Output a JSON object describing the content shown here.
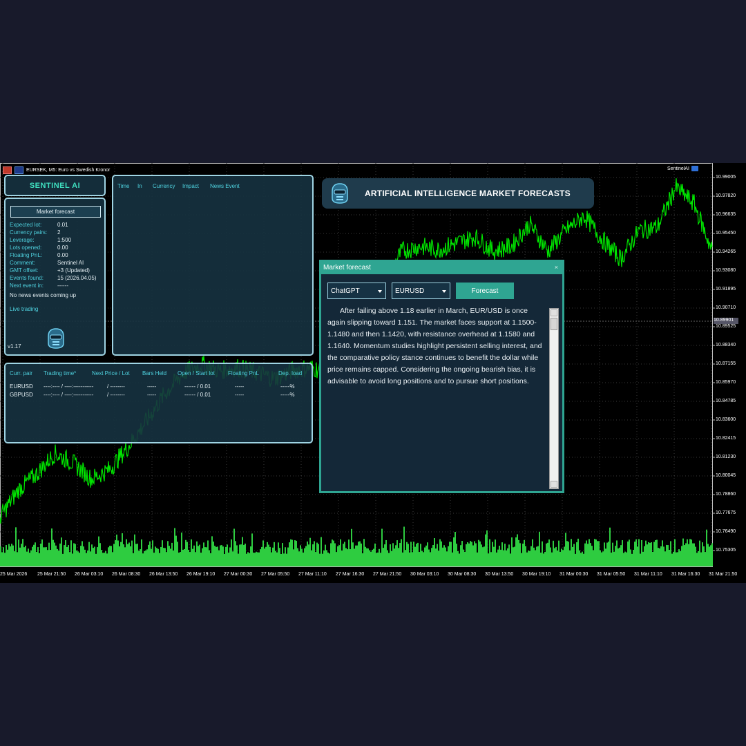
{
  "window": {
    "symbol_title": "EURSEK, M5:  Euro vs Swedish Kronor",
    "brand_tag": "SentinelAI"
  },
  "colors": {
    "accent_teal": "#2fa592",
    "price_line": "#00e600",
    "volume": "#2ecc40",
    "panel_border": "#9fd4e3",
    "label_cyan": "#4fd3e0"
  },
  "header": {
    "title": "SENTINEL AI"
  },
  "info_panel": {
    "button": "Market forecast",
    "rows": [
      {
        "label": "Expected lot:",
        "value": "0.01"
      },
      {
        "label": "Currency pairs:",
        "value": "2"
      },
      {
        "label": "Leverage:",
        "value": "1:500"
      },
      {
        "label": "Lots opened:",
        "value": "0.00"
      },
      {
        "label": "Floating PnL:",
        "value": "0.00"
      },
      {
        "label": "Comment:",
        "value": "Sentinel AI"
      },
      {
        "label": "GMT offset:",
        "value": "+3 (Updated)"
      },
      {
        "label": "Events found:",
        "value": "15 (2026.04.05)"
      },
      {
        "label": "Next event in:",
        "value": "------"
      }
    ],
    "no_news": "No news events coming up",
    "live": "Live trading",
    "version": "v1.17"
  },
  "news_panel": {
    "headers": [
      "Time",
      "In",
      "Currency",
      "Impact",
      "News Event"
    ]
  },
  "trade_panel": {
    "headers": [
      "Curr. pair",
      "Trading time*",
      "Next Price / Lot",
      "Bars Held",
      "Open / Start lot",
      "Floating PnL",
      "Dep. load"
    ],
    "rows": [
      [
        "EURUSD",
        "----:---- / ----:-----------",
        "/ --------",
        "-----",
        "------ / 0.01",
        "-----",
        "-----%"
      ],
      [
        "GBPUSD",
        "----:---- / ----:-----------",
        "/ --------",
        "-----",
        "------ / 0.01",
        "-----",
        "-----%"
      ]
    ]
  },
  "banner": {
    "title": "ARTIFICIAL INTELLIGENCE MARKET FORECASTS"
  },
  "dialog": {
    "title": "Market forecast",
    "close": "×",
    "model": "ChatGPT",
    "pair": "EURUSD",
    "button": "Forecast",
    "text": "After failing above 1.18 earlier in March, EUR/USD is once again slipping toward 1.151. The market faces support at 1.1500-1.1480 and then 1.1420, with resistance overhead at 1.1580 and 1.1640. Momentum studies highlight persistent selling interest, and the comparative policy stance continues to benefit the dollar while price remains capped. Considering the ongoing bearish bias, it is advisable to avoid long positions and to pursue short positions."
  },
  "chart_data": {
    "type": "line",
    "title": "EURSEK, M5:  Euro vs Swedish Kronor",
    "y_ticks": [
      "10.99005",
      "10.97820",
      "10.96635",
      "10.95450",
      "10.94265",
      "10.93080",
      "10.91895",
      "10.90710",
      "10.89525",
      "10.88340",
      "10.87155",
      "10.85970",
      "10.84785",
      "10.83600",
      "10.82415",
      "10.81230",
      "10.80045",
      "10.78860",
      "10.77675",
      "10.76490",
      "10.75305"
    ],
    "current_price": "10.89901",
    "x_ticks": [
      "25 Mar 2026",
      "25 Mar 21:50",
      "26 Mar 03:10",
      "26 Mar 08:30",
      "26 Mar 13:50",
      "26 Mar 19:10",
      "27 Mar 00:30",
      "27 Mar 05:50",
      "27 Mar 11:10",
      "27 Mar 16:30",
      "27 Mar 21:50",
      "30 Mar 03:10",
      "30 Mar 08:30",
      "30 Mar 13:50",
      "30 Mar 19:10",
      "31 Mar 00:30",
      "31 Mar 05:50",
      "31 Mar 11:10",
      "31 Mar 16:30",
      "31 Mar 21:50"
    ],
    "ylim": [
      10.7471,
      10.9959
    ],
    "series": [
      {
        "values": [
          10.778,
          10.795,
          10.805,
          10.818,
          10.812,
          10.802,
          10.808,
          10.822,
          10.838,
          10.855,
          10.868,
          10.874,
          10.87,
          10.872,
          10.869,
          10.865,
          10.87,
          10.872,
          10.869,
          10.88,
          10.905,
          10.925,
          10.945,
          10.948,
          10.946,
          10.95,
          10.954,
          10.945,
          10.948,
          10.962,
          10.945,
          10.958,
          10.967,
          10.952,
          10.94,
          10.958,
          10.96,
          10.985,
          10.975,
          10.945
        ]
      }
    ]
  }
}
